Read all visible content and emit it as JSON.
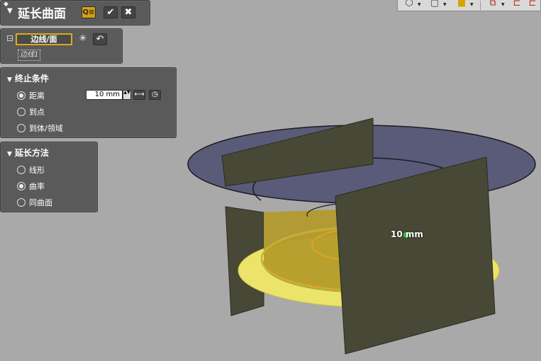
{
  "command": {
    "title": "延长曲面",
    "pin_icon": "pin-icon",
    "collapse_icon": "triangle-down-icon",
    "buttons": [
      {
        "name": "filter-search-icon",
        "glyph": "Q≡"
      },
      {
        "name": "checkmark-icon",
        "glyph": "✔"
      },
      {
        "name": "close-icon",
        "glyph": "✖"
      }
    ]
  },
  "selection": {
    "field_label": "边线/面",
    "selected_item": "边线1",
    "icons": {
      "multi_select": "✳",
      "undo": "↶"
    }
  },
  "end_condition": {
    "header": "终止条件",
    "options": [
      "距离",
      "到点",
      "到体/领域"
    ],
    "selected_index": 0,
    "distance_value": "10 mm",
    "spinner": "▲▼"
  },
  "extend_method": {
    "header": "延长方法",
    "options": [
      "线形",
      "曲率",
      "同曲面"
    ],
    "selected_index": 1
  },
  "viewport": {
    "dimension_label": "10 mm",
    "colors": {
      "background": "#a9a9a9",
      "top_surface": "#5a5b78",
      "extended_surface": "#ece46a",
      "cylinder_wall": "#b39a2a",
      "plane_faces": "#474836",
      "highlight_edge": "#e8a617",
      "handle_point": "#2fcf3f"
    }
  },
  "toolbar": {
    "icons": [
      "hexagon-icon",
      "box-view-icon",
      "shading-color-icon",
      "section-view-icon",
      "edge-view-icon"
    ]
  }
}
